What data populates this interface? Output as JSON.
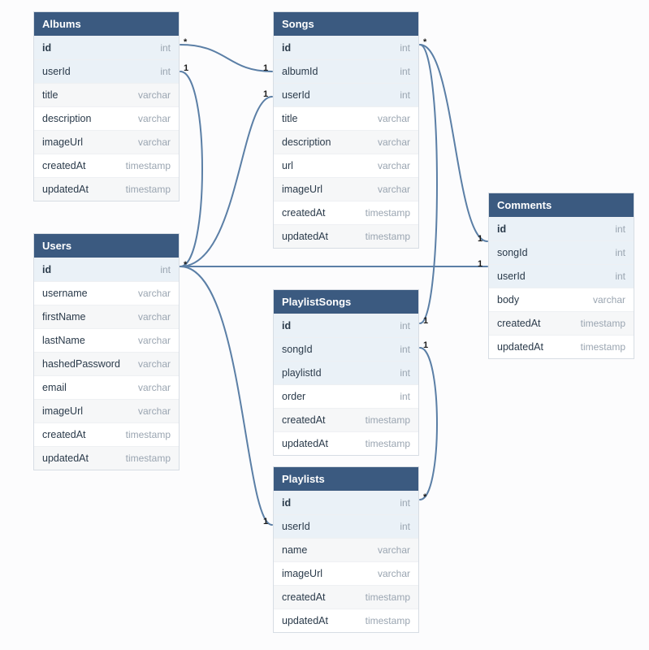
{
  "tables": {
    "albums": {
      "name": "Albums",
      "columns": [
        {
          "name": "id",
          "type": "int",
          "pk": true
        },
        {
          "name": "userId",
          "type": "int",
          "fk": true
        },
        {
          "name": "title",
          "type": "varchar"
        },
        {
          "name": "description",
          "type": "varchar"
        },
        {
          "name": "imageUrl",
          "type": "varchar"
        },
        {
          "name": "createdAt",
          "type": "timestamp"
        },
        {
          "name": "updatedAt",
          "type": "timestamp"
        }
      ]
    },
    "songs": {
      "name": "Songs",
      "columns": [
        {
          "name": "id",
          "type": "int",
          "pk": true
        },
        {
          "name": "albumId",
          "type": "int",
          "fk": true
        },
        {
          "name": "userId",
          "type": "int",
          "fk": true
        },
        {
          "name": "title",
          "type": "varchar"
        },
        {
          "name": "description",
          "type": "varchar"
        },
        {
          "name": "url",
          "type": "varchar"
        },
        {
          "name": "imageUrl",
          "type": "varchar"
        },
        {
          "name": "createdAt",
          "type": "timestamp"
        },
        {
          "name": "updatedAt",
          "type": "timestamp"
        }
      ]
    },
    "users": {
      "name": "Users",
      "columns": [
        {
          "name": "id",
          "type": "int",
          "pk": true
        },
        {
          "name": "username",
          "type": "varchar"
        },
        {
          "name": "firstName",
          "type": "varchar"
        },
        {
          "name": "lastName",
          "type": "varchar"
        },
        {
          "name": "hashedPassword",
          "type": "varchar"
        },
        {
          "name": "email",
          "type": "varchar"
        },
        {
          "name": "imageUrl",
          "type": "varchar"
        },
        {
          "name": "createdAt",
          "type": "timestamp"
        },
        {
          "name": "updatedAt",
          "type": "timestamp"
        }
      ]
    },
    "playlistsongs": {
      "name": "PlaylistSongs",
      "columns": [
        {
          "name": "id",
          "type": "int",
          "pk": true
        },
        {
          "name": "songId",
          "type": "int",
          "fk": true
        },
        {
          "name": "playlistId",
          "type": "int",
          "fk": true
        },
        {
          "name": "order",
          "type": "int"
        },
        {
          "name": "createdAt",
          "type": "timestamp"
        },
        {
          "name": "updatedAt",
          "type": "timestamp"
        }
      ]
    },
    "comments": {
      "name": "Comments",
      "columns": [
        {
          "name": "id",
          "type": "int",
          "pk": true
        },
        {
          "name": "songId",
          "type": "int",
          "fk": true
        },
        {
          "name": "userId",
          "type": "int",
          "fk": true
        },
        {
          "name": "body",
          "type": "varchar"
        },
        {
          "name": "createdAt",
          "type": "timestamp"
        },
        {
          "name": "updatedAt",
          "type": "timestamp"
        }
      ]
    },
    "playlists": {
      "name": "Playlists",
      "columns": [
        {
          "name": "id",
          "type": "int",
          "pk": true
        },
        {
          "name": "userId",
          "type": "int",
          "fk": true
        },
        {
          "name": "name",
          "type": "varchar"
        },
        {
          "name": "imageUrl",
          "type": "varchar"
        },
        {
          "name": "createdAt",
          "type": "timestamp"
        },
        {
          "name": "updatedAt",
          "type": "timestamp"
        }
      ]
    }
  },
  "relationships": [
    {
      "from": "Albums.id",
      "to": "Songs.albumId",
      "card_from": "*",
      "card_to": "1"
    },
    {
      "from": "Users.id",
      "to": "Albums.userId",
      "card_from": "*",
      "card_to": "1"
    },
    {
      "from": "Users.id",
      "to": "Songs.userId",
      "card_from": "*",
      "card_to": "1"
    },
    {
      "from": "Users.id",
      "to": "Playlists.userId",
      "card_from": "*",
      "card_to": "1"
    },
    {
      "from": "Users.id",
      "to": "Comments.userId",
      "card_from": "*",
      "card_to": "1"
    },
    {
      "from": "Songs.id",
      "to": "Comments.songId",
      "card_from": "*",
      "card_to": "1"
    },
    {
      "from": "Songs.id",
      "to": "PlaylistSongs.songId",
      "card_from": "*",
      "card_to": "1"
    },
    {
      "from": "Playlists.id",
      "to": "PlaylistSongs.playlistId",
      "card_from": "*",
      "card_to": "1"
    }
  ],
  "labels": {
    "star": "*",
    "one": "1"
  }
}
